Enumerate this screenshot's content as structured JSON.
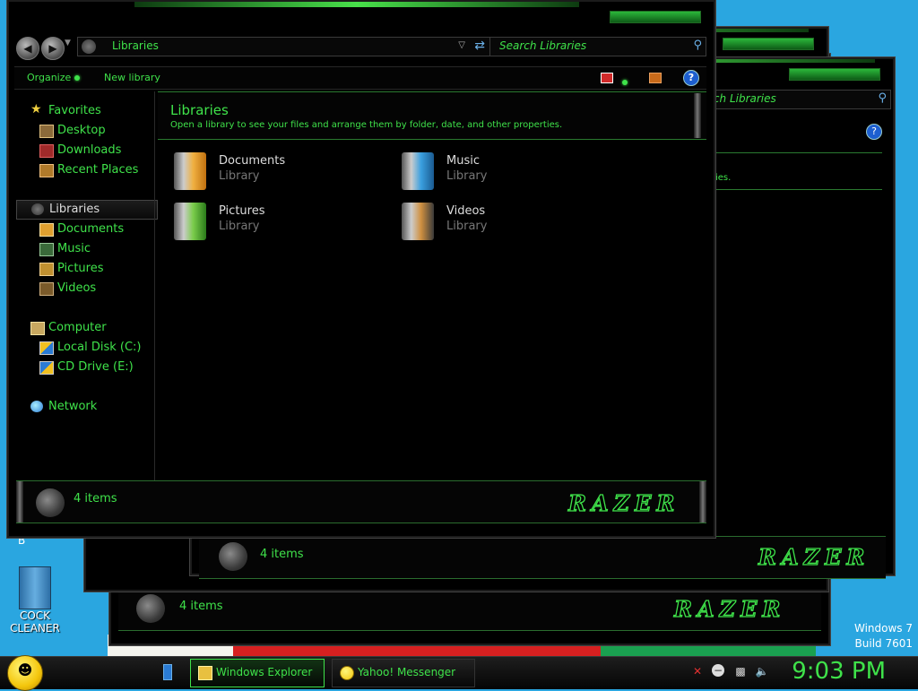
{
  "window": {
    "breadcrumb": "Libraries",
    "search_placeholder": "Search Libraries",
    "commands": {
      "organize": "Organize",
      "new_library": "New library"
    },
    "help": "?"
  },
  "nav": {
    "favorites": {
      "label": "Favorites",
      "items": [
        "Desktop",
        "Downloads",
        "Recent Places"
      ]
    },
    "libraries": {
      "label": "Libraries",
      "items": [
        "Documents",
        "Music",
        "Pictures",
        "Videos"
      ]
    },
    "computer": {
      "label": "Computer",
      "items": [
        "Local Disk (C:)",
        "CD Drive (E:)"
      ]
    },
    "network": {
      "label": "Network"
    }
  },
  "content": {
    "title": "Libraries",
    "subtitle": "Open a library to see your files and arrange them by folder, date, and other properties.",
    "libraries": [
      {
        "name": "Documents",
        "kind": "Library",
        "icon": "documents-library-icon"
      },
      {
        "name": "Music",
        "kind": "Library",
        "icon": "music-library-icon"
      },
      {
        "name": "Pictures",
        "kind": "Library",
        "icon": "pictures-library-icon"
      },
      {
        "name": "Videos",
        "kind": "Library",
        "icon": "videos-library-icon"
      }
    ]
  },
  "status": {
    "count": "4 items",
    "brand": "RAZER"
  },
  "background_windows": {
    "search_fragment": "rch Libraries",
    "subtitle_fragment": "ies.",
    "status_count": "4 items",
    "brand": "RAZER"
  },
  "desktop": {
    "icon_label_line1": "COCK",
    "icon_label_line2": "CLEANER",
    "partial_label": "B",
    "watermark_line1": "Windows 7",
    "watermark_line2": "Build 7601"
  },
  "taskbar": {
    "tasks": [
      {
        "label": "Windows Explorer",
        "active": true
      },
      {
        "label": "Yahoo! Messenger",
        "active": false
      }
    ],
    "clock": "9:03 PM"
  },
  "colors": {
    "accent": "#3fe24a",
    "window_bg": "#000000",
    "desktop_bg": "#2aa6e0",
    "secondary_text": "#777777"
  }
}
